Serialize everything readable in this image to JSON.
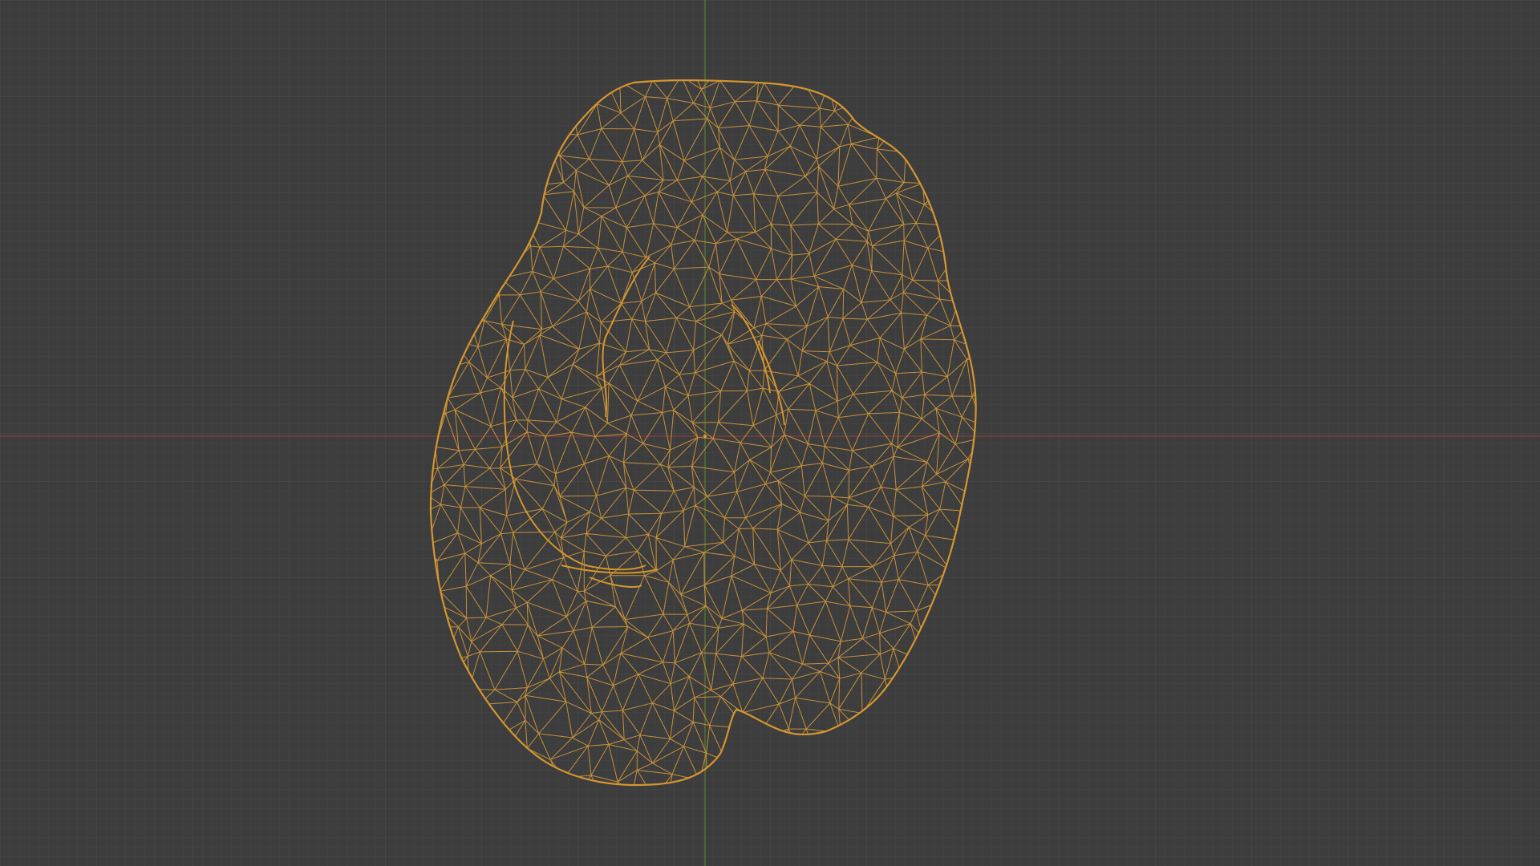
{
  "viewport": {
    "view": "3D viewport",
    "object_state": "selected",
    "shading": "wireframe"
  },
  "colors": {
    "background": "#3d3d3d",
    "grid_minor": "#454545",
    "grid_major": "#4d4d4d",
    "x_axis": "#8a3e3e",
    "y_axis": "#5b7a35",
    "wireframe": "#e3a23a",
    "outline": "#d4962f"
  }
}
